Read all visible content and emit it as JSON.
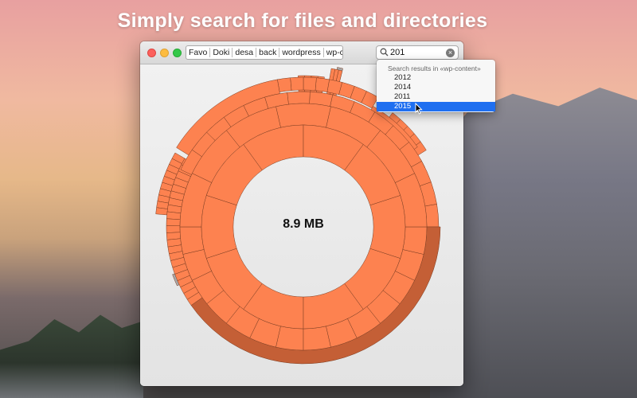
{
  "headline": "Simply search for files and directories",
  "window": {
    "breadcrumbs": [
      "Favo",
      "Doki",
      "desa",
      "back",
      "wordpress",
      "wp-content"
    ],
    "search": {
      "value": "201",
      "clear_icon": "clear-icon",
      "search_icon": "search-icon"
    },
    "center_label": "8.9 MB"
  },
  "dropdown": {
    "header": "Search results in «wp-content»",
    "items": [
      "2012",
      "2014",
      "2011",
      "2015"
    ],
    "selected": "2015"
  },
  "colors": {
    "segment": "#fd8250",
    "segment_dark": "#c45f36",
    "segment_grey": "#a8a8a8",
    "selection": "#1f6ff0"
  }
}
